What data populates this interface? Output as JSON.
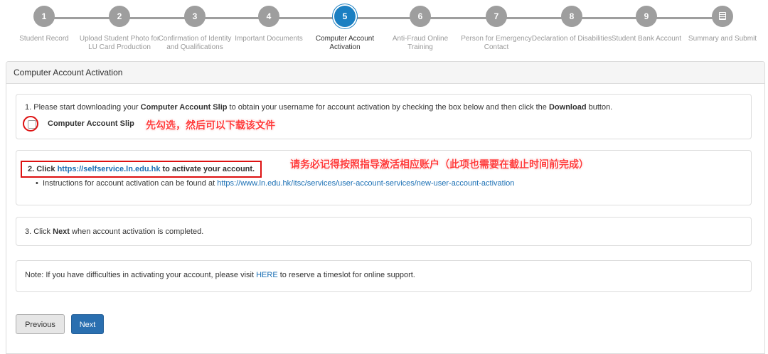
{
  "stepper": {
    "steps": [
      {
        "num": "1",
        "label": "Student Record"
      },
      {
        "num": "2",
        "label": "Upload Student Photo for LU Card Production"
      },
      {
        "num": "3",
        "label": "Confirmation of Identity and Qualifications"
      },
      {
        "num": "4",
        "label": "Important Documents"
      },
      {
        "num": "5",
        "label": "Computer Account Activation"
      },
      {
        "num": "6",
        "label": "Anti-Fraud Online Training"
      },
      {
        "num": "7",
        "label": "Person for Emergency Contact"
      },
      {
        "num": "8",
        "label": "Declaration of Disabilities"
      },
      {
        "num": "9",
        "label": "Student Bank Account"
      },
      {
        "num": "",
        "label": "Summary and Submit",
        "icon": "summary-icon"
      }
    ],
    "active_index": 4
  },
  "panel": {
    "title": "Computer Account Activation",
    "step1": {
      "prefix": "1. Please start downloading your ",
      "bold1": "Computer Account Slip",
      "middle": " to obtain your username for account activation by checking the box below and then click the ",
      "bold2": "Download",
      "suffix": " button.",
      "checkbox_label": "Computer Account Slip",
      "annotation": "先勾选，然后可以下载该文件"
    },
    "step2": {
      "prefix": "2. Click ",
      "link": "https://selfservice.ln.edu.hk",
      "suffix": " to activate your account.",
      "annotation": "请务必记得按照指导激活相应账户（此项也需要在截止时间前完成）",
      "instructions_prefix": "Instructions for account activation can be found at ",
      "instructions_link": "https://www.ln.edu.hk/itsc/services/user-account-services/new-user-account-activation"
    },
    "step3": {
      "prefix": "3. Click ",
      "bold": "Next",
      "suffix": " when account activation is completed."
    },
    "note": {
      "prefix": "Note: If you have difficulties in activating your account, please visit ",
      "link": "HERE",
      "suffix": " to reserve a timeslot for online support."
    },
    "buttons": {
      "previous": "Previous",
      "next": "Next"
    }
  },
  "colors": {
    "active_step": "#1a7fc2",
    "inactive_step": "#9e9e9e",
    "link": "#1a6fb4",
    "annotation": "#ff3b3b",
    "next_button": "#2a6fb0"
  }
}
